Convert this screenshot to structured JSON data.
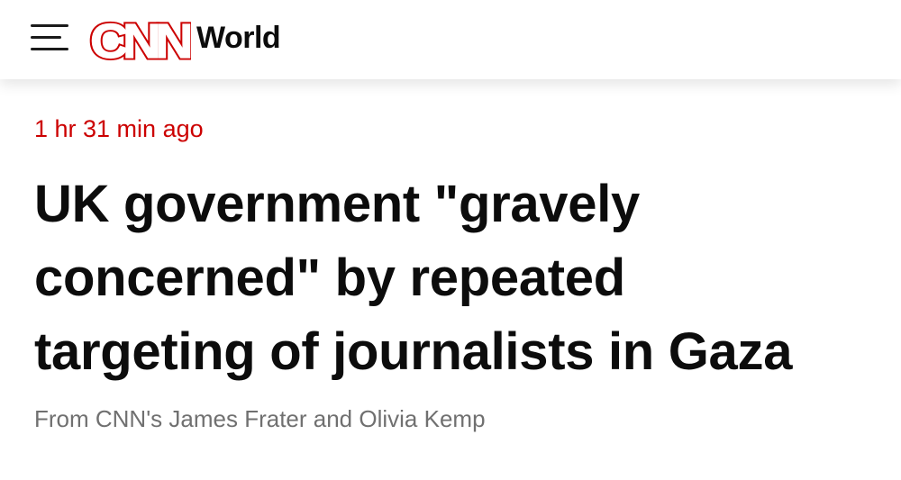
{
  "header": {
    "logo_text": "CNN",
    "section_label": "World",
    "brand_color": "#cc0000",
    "menu_icon": "hamburger-menu-icon"
  },
  "post": {
    "timestamp": "1 hr 31 min ago",
    "headline": "UK government \"gravely concerned\" by repeated targeting of journalists in Gaza",
    "byline": "From CNN's James Frater and Olivia Kemp"
  }
}
